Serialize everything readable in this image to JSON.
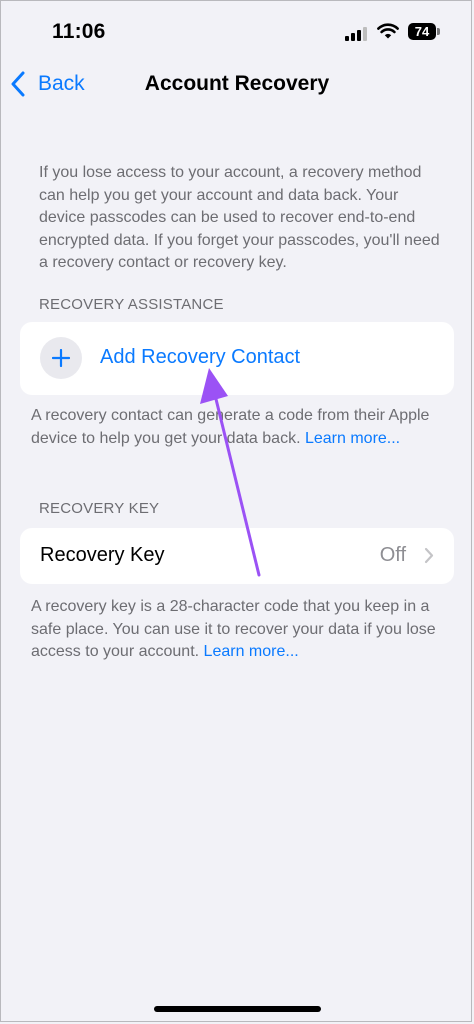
{
  "status_bar": {
    "time": "11:06",
    "battery_level": "74"
  },
  "nav": {
    "back_label": "Back",
    "title": "Account Recovery"
  },
  "intro_text": "If you lose access to your account, a recovery method can help you get your account and data back. Your device passcodes can be used to recover end-to-end encrypted data. If you forget your passcodes, you'll need a recovery contact or recovery key.",
  "recovery_assistance": {
    "header": "RECOVERY ASSISTANCE",
    "add_contact_label": "Add Recovery Contact",
    "footnote": "A recovery contact can generate a code from their Apple device to help you get your data back.",
    "learn_more": "Learn more..."
  },
  "recovery_key": {
    "header": "RECOVERY KEY",
    "row_label": "Recovery Key",
    "row_value": "Off",
    "footnote": "A recovery key is a 28-character code that you keep in a safe place. You can use it to recover your data if you lose access to your account.",
    "learn_more": "Learn more..."
  },
  "colors": {
    "accent": "#0a7aff",
    "background": "#f2f2f7",
    "annotation_arrow": "#9b52f5"
  }
}
